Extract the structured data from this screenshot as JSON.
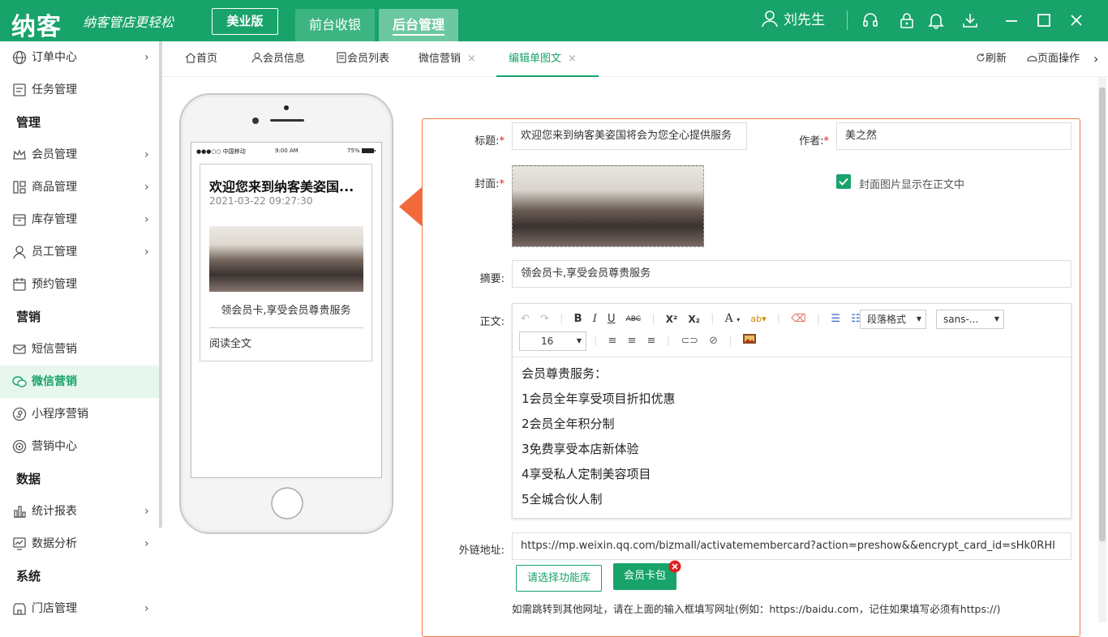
{
  "header": {
    "logo": "纳客",
    "slogan": "纳客管店更轻松",
    "edition": "美业版",
    "nav": [
      "前台收银",
      "后台管理"
    ],
    "user": "刘先生"
  },
  "sidebar": {
    "items": [
      {
        "label": "订单中心",
        "arrow": "›"
      },
      {
        "label": "任务管理",
        "arrow": ""
      },
      {
        "label": "会员管理",
        "arrow": "›"
      },
      {
        "label": "商品管理",
        "arrow": "›"
      },
      {
        "label": "库存管理",
        "arrow": "›"
      },
      {
        "label": "员工管理",
        "arrow": "›"
      },
      {
        "label": "预约管理",
        "arrow": ""
      },
      {
        "label": "短信营销",
        "arrow": ""
      },
      {
        "label": "微信营销",
        "arrow": ""
      },
      {
        "label": "小程序营销",
        "arrow": ""
      },
      {
        "label": "营销中心",
        "arrow": ""
      },
      {
        "label": "统计报表",
        "arrow": "›"
      },
      {
        "label": "数据分析",
        "arrow": "›"
      },
      {
        "label": "门店管理",
        "arrow": "›"
      }
    ],
    "headers": [
      "管理",
      "营销",
      "数据",
      "系统"
    ]
  },
  "tabs": {
    "items": [
      "首页",
      "会员信息",
      "会员列表",
      "微信营销",
      "编辑单图文"
    ],
    "close": "×",
    "refresh": "刷新",
    "page_ops": "页面操作",
    "more": "›"
  },
  "preview": {
    "carrier": "●●●○○ 中国移动",
    "time": "9:00 AM",
    "battery": "75%",
    "title": "欢迎您来到纳客美姿国...",
    "date": "2021-03-22 09:27:30",
    "summary": "领会员卡,享受会员尊贵服务",
    "read_more": "阅读全文"
  },
  "form": {
    "title_label": "标题:",
    "title_value": "欢迎您来到纳客美姿国将会为您全心提供服务",
    "author_label": "作者:",
    "author_value": "美之然",
    "cover_label": "封面:",
    "cover_checkbox_label": "封面图片显示在正文中",
    "summary_label": "摘要:",
    "summary_value": "领会员卡,享受会员尊贵服务",
    "body_label": "正文:",
    "link_label": "外链地址:",
    "link_value": "https://mp.weixin.qq.com/bizmall/activatemembercard?action=preshow&&encrypt_card_id=sHk0RHI",
    "btn_library": "请选择功能库",
    "btn_card": "会员卡包",
    "hint": "如需跳转到其他网址，请在上面的输入框填写网址(例如：https://baidu.com，记住如果填写必须有https://)",
    "required_mark": "*"
  },
  "editor": {
    "paragraph_select": "段落格式",
    "font_select": "sans-...",
    "size_select": "16",
    "toolbar_text": {
      "bold": "B",
      "italic": "I",
      "underline": "U",
      "strike": "ABC",
      "sup": "X²",
      "sub": "X₂",
      "font_color": "A"
    },
    "lines": [
      "会员尊贵服务：",
      "1会员全年享受项目折扣优惠",
      "2会员全年积分制",
      "3免费享受本店新体验",
      "4享受私人定制美容项目",
      "5全城合伙人制"
    ]
  },
  "colors": {
    "primary": "#18a36a",
    "accent": "#f07c4a",
    "danger": "#e02020"
  }
}
